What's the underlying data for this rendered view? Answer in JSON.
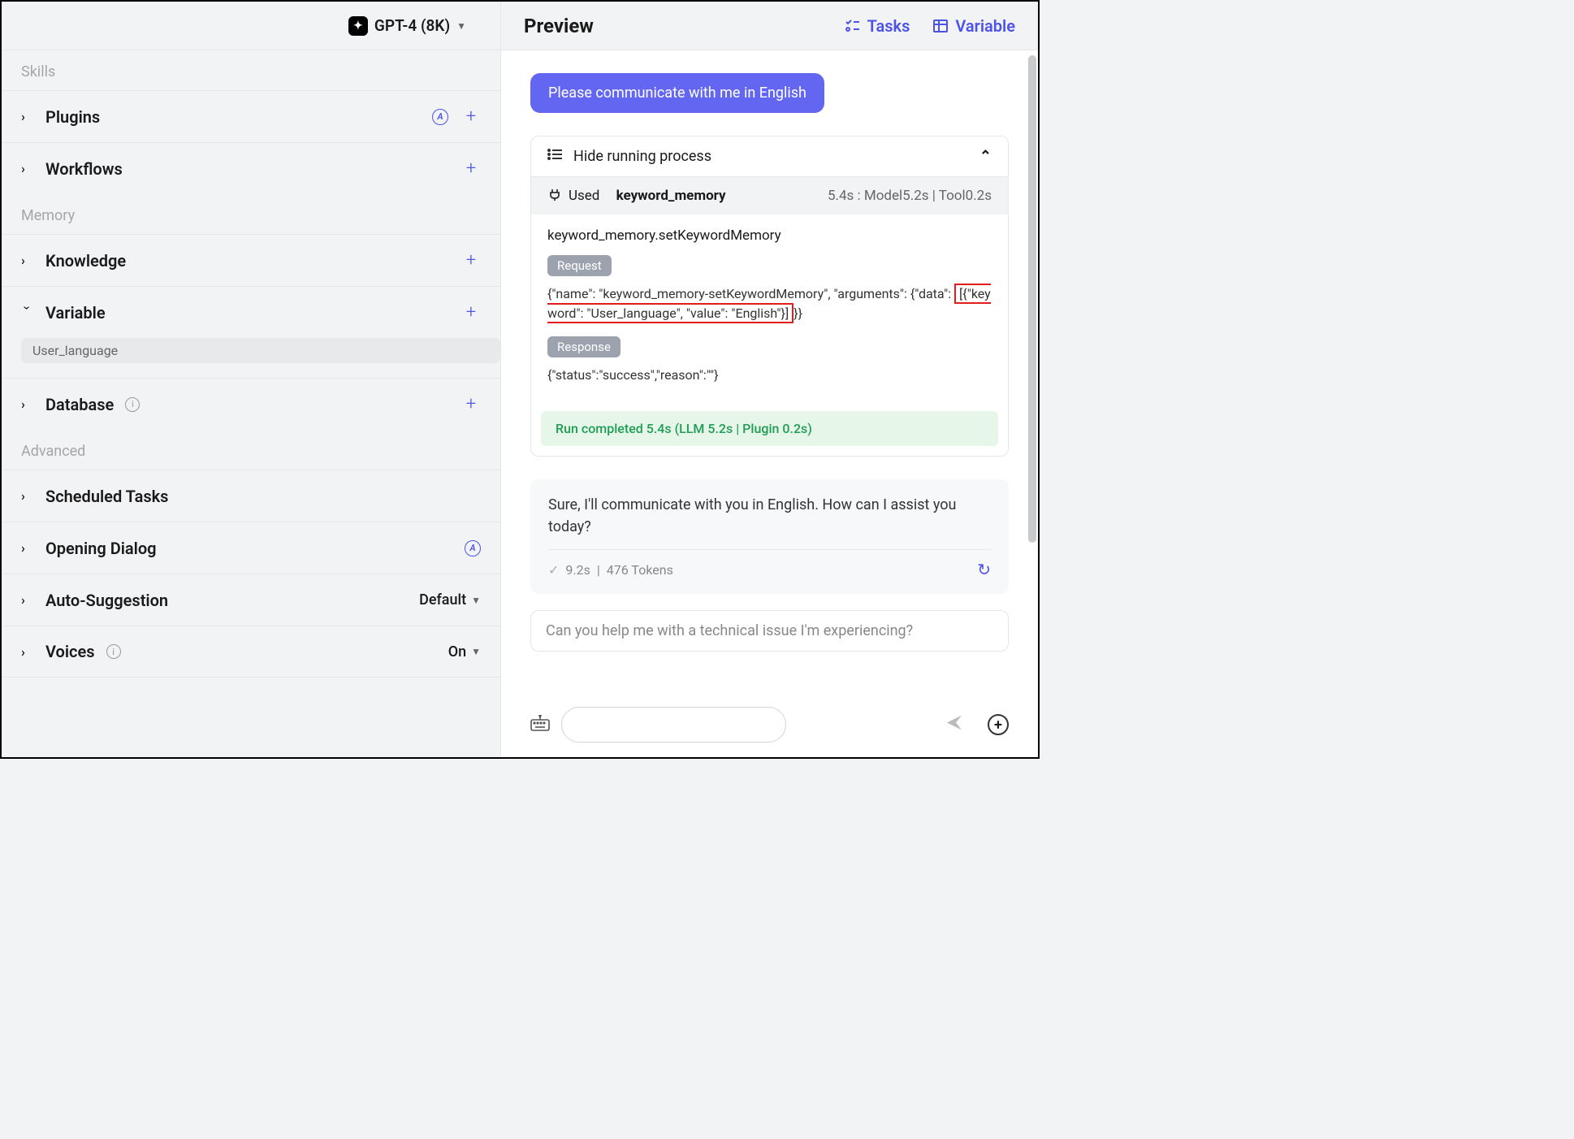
{
  "model": {
    "name": "GPT-4 (8K)"
  },
  "sections": {
    "skills": "Skills",
    "memory": "Memory",
    "advanced": "Advanced"
  },
  "items": {
    "plugins": "Plugins",
    "workflows": "Workflows",
    "knowledge": "Knowledge",
    "variable": "Variable",
    "database": "Database",
    "scheduled": "Scheduled Tasks",
    "opening": "Opening Dialog",
    "autosuggest": "Auto-Suggestion",
    "autosuggest_value": "Default",
    "voices": "Voices",
    "voices_value": "On"
  },
  "variable_tag": "User_language",
  "preview": {
    "title": "Preview",
    "tasks": "Tasks",
    "variable": "Variable"
  },
  "chat": {
    "user_msg": "Please communicate with me in English",
    "hide_process": "Hide running process",
    "used_label": "Used",
    "used_tool": "keyword_memory",
    "used_time": "5.4s : Model5.2s | Tool0.2s",
    "call_name": "keyword_memory.setKeywordMemory",
    "request_label": "Request",
    "request_pre": "{\"name\": \"keyword_memory-setKeywordMemory\", \"arguments\": {\"data\": ",
    "request_boxed": "[{\"keyword\": \"User_language\", \"value\": \"English\"}]",
    "request_post": "}}",
    "response_label": "Response",
    "response_body": "{\"status\":\"success\",\"reason\":\"\"}",
    "run_completed": "Run completed 5.4s  (LLM 5.2s | Plugin 0.2s)",
    "assistant_msg": "Sure, I'll communicate with you in English. How can I assist you today?",
    "assistant_time": "9.2s",
    "assistant_tokens": "476 Tokens",
    "suggestion": "Can you help me with a technical issue I'm experiencing?"
  }
}
